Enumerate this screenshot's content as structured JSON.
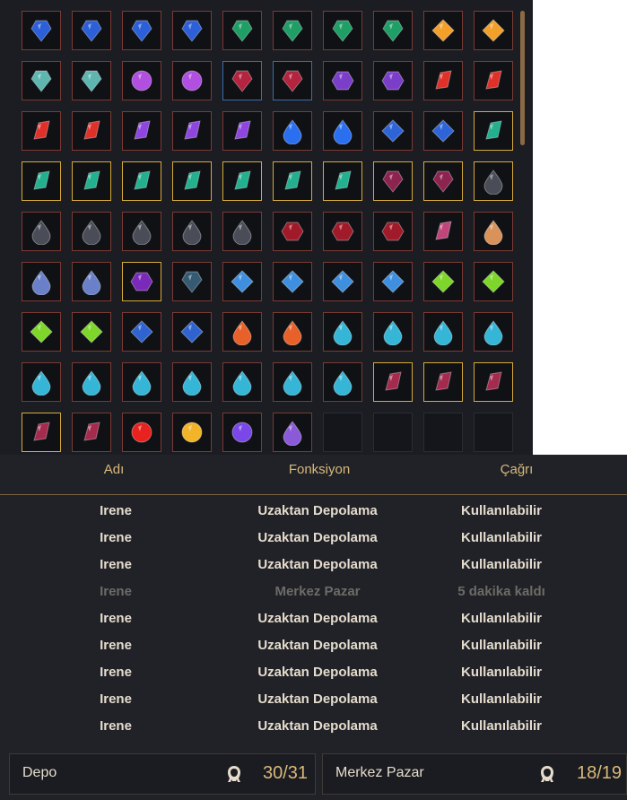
{
  "inventory": {
    "rows": [
      [
        {
          "gem": "blue-crystal",
          "frame": "red"
        },
        {
          "gem": "blue-crystal",
          "frame": "red"
        },
        {
          "gem": "blue-crystal",
          "frame": "red"
        },
        {
          "gem": "blue-crystal",
          "frame": "red"
        },
        {
          "gem": "green-crystal",
          "frame": "red"
        },
        {
          "gem": "green-crystal",
          "frame": "red"
        },
        {
          "gem": "green-crystal",
          "frame": "red"
        },
        {
          "gem": "green-crystal",
          "frame": "red"
        },
        {
          "gem": "orange-star",
          "frame": "red"
        },
        {
          "gem": "orange-star",
          "frame": "red"
        }
      ],
      [
        {
          "gem": "blue-green-ore",
          "frame": "red"
        },
        {
          "gem": "blue-green-ore",
          "frame": "red"
        },
        {
          "gem": "purple-round",
          "frame": "red"
        },
        {
          "gem": "purple-round",
          "frame": "red"
        },
        {
          "gem": "crimson-gem",
          "frame": "blue"
        },
        {
          "gem": "crimson-gem",
          "frame": "blue"
        },
        {
          "gem": "violet-hexagon",
          "frame": "red"
        },
        {
          "gem": "violet-hexagon",
          "frame": "red"
        },
        {
          "gem": "red-shard",
          "frame": "red"
        },
        {
          "gem": "red-shard",
          "frame": "red"
        }
      ],
      [
        {
          "gem": "red-shard",
          "frame": "red"
        },
        {
          "gem": "red-shard",
          "frame": "red"
        },
        {
          "gem": "violet-shard",
          "frame": "red"
        },
        {
          "gem": "violet-shard",
          "frame": "red"
        },
        {
          "gem": "violet-shard",
          "frame": "red"
        },
        {
          "gem": "blue-drop",
          "frame": "red"
        },
        {
          "gem": "blue-drop",
          "frame": "red"
        },
        {
          "gem": "blue-triangle",
          "frame": "red"
        },
        {
          "gem": "blue-triangle",
          "frame": "red"
        },
        {
          "gem": "teal-leaf",
          "frame": "yellow"
        }
      ],
      [
        {
          "gem": "teal-leaf",
          "frame": "yellow"
        },
        {
          "gem": "teal-leaf",
          "frame": "yellow"
        },
        {
          "gem": "teal-leaf",
          "frame": "yellow"
        },
        {
          "gem": "teal-leaf",
          "frame": "yellow"
        },
        {
          "gem": "teal-leaf",
          "frame": "yellow"
        },
        {
          "gem": "teal-leaf",
          "frame": "yellow"
        },
        {
          "gem": "teal-leaf",
          "frame": "yellow"
        },
        {
          "gem": "wine-gem",
          "frame": "yellow"
        },
        {
          "gem": "wine-gem",
          "frame": "yellow"
        },
        {
          "gem": "dark-drop",
          "frame": "yellow"
        }
      ],
      [
        {
          "gem": "dark-drop",
          "frame": "red"
        },
        {
          "gem": "dark-drop",
          "frame": "red"
        },
        {
          "gem": "dark-drop",
          "frame": "red"
        },
        {
          "gem": "dark-drop",
          "frame": "red"
        },
        {
          "gem": "dark-drop",
          "frame": "red"
        },
        {
          "gem": "red-cluster",
          "frame": "red"
        },
        {
          "gem": "red-cluster",
          "frame": "red"
        },
        {
          "gem": "red-cluster",
          "frame": "red"
        },
        {
          "gem": "pink-shard",
          "frame": "red"
        },
        {
          "gem": "amber-drop",
          "frame": "red"
        }
      ],
      [
        {
          "gem": "silver-blue-drop",
          "frame": "red"
        },
        {
          "gem": "silver-blue-drop",
          "frame": "red"
        },
        {
          "gem": "purple-box",
          "frame": "yellow"
        },
        {
          "gem": "slate-crystal",
          "frame": "red"
        },
        {
          "gem": "blue-diamond",
          "frame": "red"
        },
        {
          "gem": "blue-diamond",
          "frame": "red"
        },
        {
          "gem": "blue-diamond",
          "frame": "red"
        },
        {
          "gem": "blue-diamond",
          "frame": "red"
        },
        {
          "gem": "green-diamond",
          "frame": "red"
        },
        {
          "gem": "green-diamond",
          "frame": "red"
        }
      ],
      [
        {
          "gem": "green-diamond",
          "frame": "red"
        },
        {
          "gem": "green-diamond",
          "frame": "red"
        },
        {
          "gem": "blue-facet",
          "frame": "red"
        },
        {
          "gem": "blue-facet",
          "frame": "red"
        },
        {
          "gem": "orange-drop",
          "frame": "red"
        },
        {
          "gem": "orange-drop",
          "frame": "red"
        },
        {
          "gem": "cyan-drop",
          "frame": "red"
        },
        {
          "gem": "cyan-drop",
          "frame": "red"
        },
        {
          "gem": "cyan-drop",
          "frame": "red"
        },
        {
          "gem": "cyan-drop",
          "frame": "red"
        }
      ],
      [
        {
          "gem": "cyan-drop",
          "frame": "red"
        },
        {
          "gem": "cyan-drop",
          "frame": "red"
        },
        {
          "gem": "cyan-drop",
          "frame": "red"
        },
        {
          "gem": "cyan-drop",
          "frame": "red"
        },
        {
          "gem": "cyan-drop",
          "frame": "red"
        },
        {
          "gem": "cyan-drop",
          "frame": "red"
        },
        {
          "gem": "cyan-drop",
          "frame": "red"
        },
        {
          "gem": "garnet-shard",
          "frame": "yellow"
        },
        {
          "gem": "garnet-shard",
          "frame": "yellow"
        },
        {
          "gem": "garnet-shard",
          "frame": "yellow"
        }
      ],
      [
        {
          "gem": "garnet-shard",
          "frame": "yellow"
        },
        {
          "gem": "garnet-shard",
          "frame": "red"
        },
        {
          "gem": "red-orb",
          "frame": "red"
        },
        {
          "gem": "gold-orb",
          "frame": "red"
        },
        {
          "gem": "violet-orb",
          "frame": "red"
        },
        {
          "gem": "violet-egg",
          "frame": "red"
        },
        {
          "gem": "",
          "frame": "empty"
        },
        {
          "gem": "",
          "frame": "empty"
        },
        {
          "gem": "",
          "frame": "empty"
        },
        {
          "gem": "",
          "frame": "empty"
        }
      ]
    ],
    "gem_colors": {
      "blue-crystal": "#2c5fd8",
      "green-crystal": "#1f9e66",
      "orange-star": "#f2a02a",
      "blue-green-ore": "#5fb6b0",
      "purple-round": "#b14fe0",
      "crimson-gem": "#b3243f",
      "violet-hexagon": "#7b3ec9",
      "red-shard": "#e0302a",
      "violet-shard": "#8f45e0",
      "blue-drop": "#2a6ff0",
      "blue-triangle": "#2d64d8",
      "teal-leaf": "#22b08e",
      "wine-gem": "#8d2450",
      "dark-drop": "#4a4d58",
      "red-cluster": "#a01a2a",
      "pink-shard": "#c0457a",
      "amber-drop": "#d8925a",
      "silver-blue-drop": "#6a80c8",
      "purple-box": "#7a2ab8",
      "slate-crystal": "#355a72",
      "blue-diamond": "#3f8fe0",
      "green-diamond": "#7fd62a",
      "blue-facet": "#2f63d0",
      "orange-drop": "#e8612a",
      "cyan-drop": "#36b6d6",
      "garnet-shard": "#a42a4e",
      "red-orb": "#e8221e",
      "gold-orb": "#f2b52a",
      "violet-orb": "#7a48e8",
      "violet-egg": "#8a5ad8"
    },
    "scroll_position_fraction": 0.0
  },
  "list": {
    "headers": {
      "name": "Adı",
      "function": "Fonksiyon",
      "call": "Çağrı"
    },
    "rows": [
      {
        "name": "Irene",
        "function": "Uzaktan Depolama",
        "call": "Kullanılabilir",
        "disabled": false
      },
      {
        "name": "Irene",
        "function": "Uzaktan Depolama",
        "call": "Kullanılabilir",
        "disabled": false
      },
      {
        "name": "Irene",
        "function": "Uzaktan Depolama",
        "call": "Kullanılabilir",
        "disabled": false
      },
      {
        "name": "Irene",
        "function": "Merkez Pazar",
        "call": "5 dakika kaldı",
        "disabled": true
      },
      {
        "name": "Irene",
        "function": "Uzaktan Depolama",
        "call": "Kullanılabilir",
        "disabled": false
      },
      {
        "name": "Irene",
        "function": "Uzaktan Depolama",
        "call": "Kullanılabilir",
        "disabled": false
      },
      {
        "name": "Irene",
        "function": "Uzaktan Depolama",
        "call": "Kullanılabilir",
        "disabled": false
      },
      {
        "name": "Irene",
        "function": "Uzaktan Depolama",
        "call": "Kullanılabilir",
        "disabled": false
      },
      {
        "name": "Irene",
        "function": "Uzaktan Depolama",
        "call": "Kullanılabilir",
        "disabled": false
      }
    ]
  },
  "footer": {
    "storage": {
      "label": "Depo",
      "count": "30/31",
      "icon": "maid-icon"
    },
    "market": {
      "label": "Merkez Pazar",
      "count": "18/19",
      "icon": "maid-icon"
    }
  }
}
